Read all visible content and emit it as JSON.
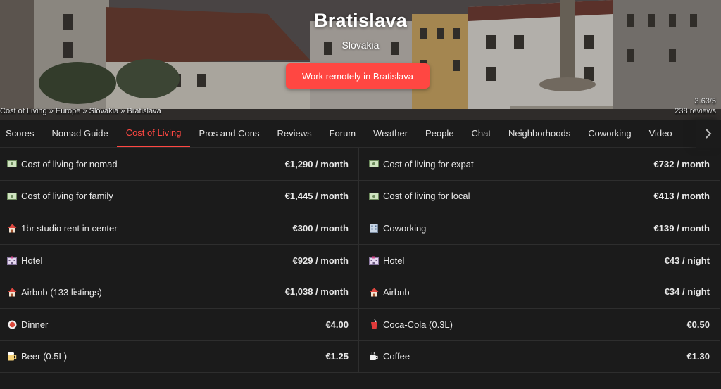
{
  "hero": {
    "city": "Bratislava",
    "country": "Slovakia",
    "cta_label": "Work remotely in Bratislava",
    "breadcrumb": [
      "Cost of Living",
      "Europe",
      "Slovakia",
      "Bratislava"
    ],
    "breadcrumb_sep": " » ",
    "score": "3.63/5",
    "reviews": "238 reviews"
  },
  "tabs": [
    "Scores",
    "Nomad Guide",
    "Cost of Living",
    "Pros and Cons",
    "Reviews",
    "Forum",
    "Weather",
    "People",
    "Chat",
    "Neighborhoods",
    "Coworking",
    "Video"
  ],
  "active_tab": "Cost of Living",
  "colors": {
    "accent": "#ff4742",
    "background": "#1b1b1b",
    "divider": "#2e2e2e"
  },
  "costs": {
    "left": [
      {
        "icon": "money-icon",
        "label": "Cost of living for nomad",
        "value": "€1,290 / month",
        "link": false
      },
      {
        "icon": "money-icon",
        "label": "Cost of living for family",
        "value": "€1,445 / month",
        "link": false
      },
      {
        "icon": "house-icon",
        "label": "1br studio rent in center",
        "value": "€300 / month",
        "link": false
      },
      {
        "icon": "hotel-icon",
        "label": "Hotel",
        "value": "€929 / month",
        "link": false
      },
      {
        "icon": "house-icon",
        "label": "Airbnb (133 listings)",
        "value": "€1,038 / month",
        "link": true
      },
      {
        "icon": "dinner-icon",
        "label": "Dinner",
        "value": "€4.00",
        "link": false
      },
      {
        "icon": "beer-icon",
        "label": "Beer (0.5L)",
        "value": "€1.25",
        "link": false
      }
    ],
    "right": [
      {
        "icon": "money-icon",
        "label": "Cost of living for expat",
        "value": "€732 / month",
        "link": false
      },
      {
        "icon": "money-icon",
        "label": "Cost of living for local",
        "value": "€413 / month",
        "link": false
      },
      {
        "icon": "office-icon",
        "label": "Coworking",
        "value": "€139 / month",
        "link": false
      },
      {
        "icon": "hotel-icon",
        "label": "Hotel",
        "value": "€43 / night",
        "link": false
      },
      {
        "icon": "house-icon",
        "label": "Airbnb",
        "value": "€34 / night",
        "link": true
      },
      {
        "icon": "cola-icon",
        "label": "Coca-Cola (0.3L)",
        "value": "€0.50",
        "link": false
      },
      {
        "icon": "coffee-icon",
        "label": "Coffee",
        "value": "€1.30",
        "link": false
      }
    ]
  }
}
